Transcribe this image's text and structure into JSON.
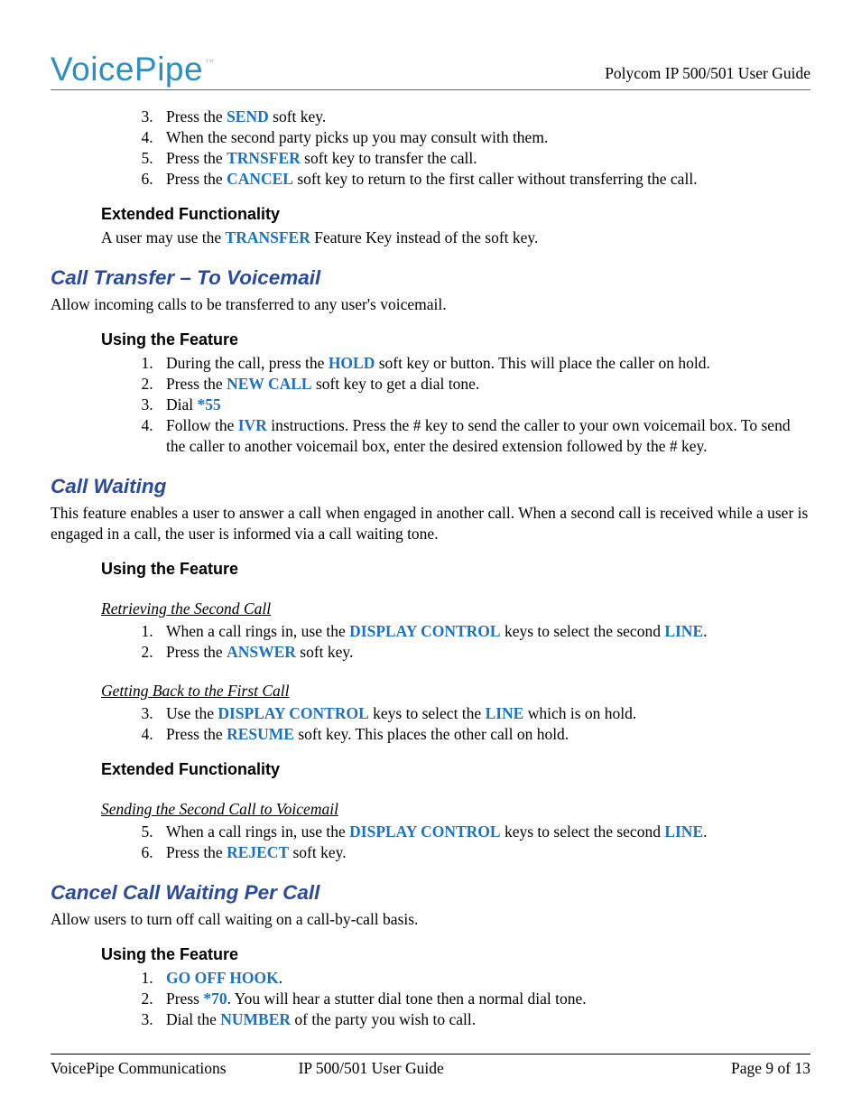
{
  "brand": {
    "name": "VoicePipe",
    "tm": "™"
  },
  "header_right": "Polycom IP 500/501 User Guide",
  "k": {
    "send": "SEND",
    "trnsfer": "TRNSFER",
    "cancel": "CANCEL",
    "transfer": "TRANSFER",
    "hold": "HOLD",
    "newcall": "NEW CALL",
    "star55": "*55",
    "ivr": "IVR",
    "display": "DISPLAY CONTROL",
    "line": "LINE",
    "answer": "ANSWER",
    "resume": "RESUME",
    "reject": "REJECT",
    "offhook": "GO OFF HOOK",
    "star70": "*70",
    "number": "NUMBER"
  },
  "t": {
    "s3a": "Press the ",
    "s3b": " soft key.",
    "s4": "When the second party picks up you may consult with them.",
    "s5a": "Press the ",
    "s5b": " soft key to transfer the call.",
    "s6a": "Press the ",
    "s6b": " soft key to return to the first caller without transferring the call.",
    "ext_h": "Extended Functionality",
    "ext_p1a": "A user may use the ",
    "ext_p1b": " Feature Key instead of the soft key.",
    "ctv_h": "Call Transfer – To Voicemail",
    "ctv_p": "Allow incoming calls to be transferred to any user's voicemail.",
    "utf_h": "Using the Feature",
    "ctv1a": "During the call, press the ",
    "ctv1b": " soft key or button.  This will place the caller on hold.",
    "ctv2a": "Press the ",
    "ctv2b": " soft key to get a dial tone.",
    "ctv3a": "Dial ",
    "ctv4a": "Follow the ",
    "ctv4b": " instructions.  Press the # key to send the caller to your own voicemail box.  To send the caller to another voicemail box, enter the desired extension followed by the # key.",
    "cw_h": "Call Waiting",
    "cw_p": "This feature enables a user to answer a call when engaged in another call. When a second call is received while a user is engaged in a call, the user is informed via a call waiting tone.",
    "ret_h": "Retrieving the Second Call",
    "cw1a": "When a call rings in, use the ",
    "cw1b": " keys to select the second ",
    "cw1c": ".",
    "cw2a": "Press the ",
    "cw2b": " soft key.",
    "get_h": "Getting Back to the First Call",
    "cw3a": "Use the ",
    "cw3b": " keys to select the ",
    "cw3c": " which is on hold.",
    "cw4a": "Press the ",
    "cw4b": " soft key.  This places the other call on hold.",
    "send_h": "Sending the Second Call to Voicemail",
    "cw5a": "When a call rings in, use the ",
    "cw5b": " keys to select the second ",
    "cw5c": ".",
    "cw6a": "Press the ",
    "cw6b": " soft key.",
    "ccw_h": "Cancel Call Waiting Per Call",
    "ccw_p": "Allow users to turn off call waiting on a call-by-call basis.",
    "ccw1b": ".",
    "ccw2a": "Press ",
    "ccw2b": ". You will hear a stutter dial tone then a normal dial tone.",
    "ccw3a": "Dial the ",
    "ccw3b": " of the party you wish to call."
  },
  "footer": {
    "left": "VoicePipe Communications",
    "mid": "IP 500/501 User Guide",
    "right": "Page 9 of 13"
  }
}
